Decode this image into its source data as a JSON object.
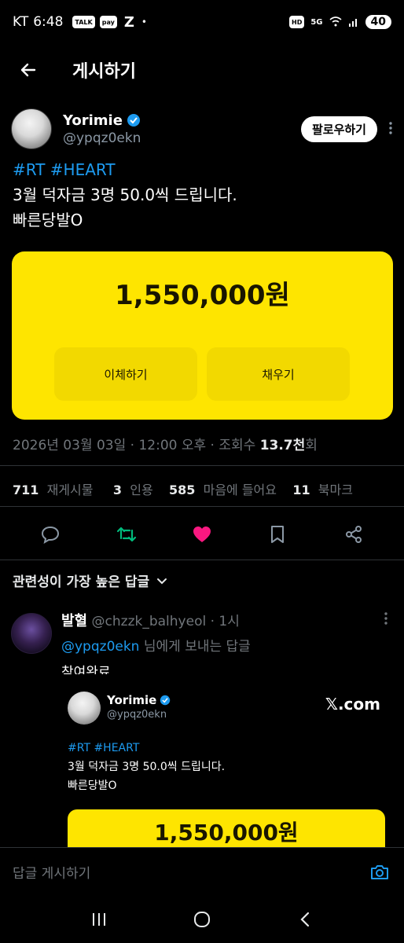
{
  "status_bar": {
    "carrier": "KT",
    "time": "6:48",
    "icons": [
      "talk-icon",
      "pay-icon",
      "z-icon"
    ],
    "talk_label": "TALK",
    "pay_label": "pay",
    "z_label": "Z",
    "dot": "•",
    "hd_label": "HD",
    "net_label": "5G",
    "battery": "40"
  },
  "header": {
    "title": "게시하기"
  },
  "post": {
    "author_name": "Yorimie",
    "author_handle": "@ypqz0ekn",
    "follow_label": "팔로우하기",
    "hashtags": "#RT #HEART",
    "line1": "3월 덕자금 3명 50.0씩 드립니다.",
    "line2": "빠른당발O",
    "card": {
      "amount": "1,550,000원",
      "button1": "이체하기",
      "button2": "채우기",
      "color": "#fee500"
    },
    "meta_date": "2026년 03월 03일 · 12:00 오후 · 조회수 ",
    "meta_views": "13.7천",
    "meta_views_suffix": "회",
    "stats": {
      "reposts_count": "711",
      "reposts_label": "재게시물",
      "quotes_count": "3",
      "quotes_label": "인용",
      "likes_count": "585",
      "likes_label": "마음에 들어요",
      "bookmarks_count": "11",
      "bookmarks_label": "북마크"
    }
  },
  "replies": {
    "sort_label": "관련성이 가장 높은 답글"
  },
  "reply": {
    "name": "발혈",
    "handle": "@chzzk_balhyeol",
    "time": " · 1시",
    "mention": "@ypqz0ekn",
    "to_suffix": " 님에게 보내는 답글",
    "text": "참여완료",
    "embed": {
      "name": "Yorimie",
      "handle": "@ypqz0ekn",
      "brand": "𝕏.com",
      "hashtags": "#RT #HEART",
      "line1": "3월 덕자금 3명 50.0씩 드립니다.",
      "line2": "빠른당발O",
      "amount": "1,550,000원"
    }
  },
  "composer": {
    "placeholder": "답글 게시하기"
  },
  "colors": {
    "accent": "#1d9bf0",
    "like": "#f91880",
    "repost": "#00ba7c"
  }
}
